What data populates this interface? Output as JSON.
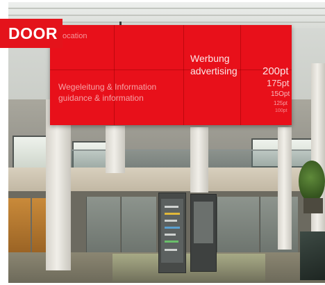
{
  "badge": {
    "text": "DOOR"
  },
  "led_wall": {
    "top_left": "ocation",
    "guidance_de": "Wegeleitung & Information",
    "guidance_en": "guidance & information",
    "ad_de": "Werbung",
    "ad_en": "advertising",
    "size_1": "200pt",
    "size_2": "175pt",
    "size_3": "15Opt",
    "size_4": "125pt",
    "size_5": "100pt"
  },
  "colors": {
    "led_red": "#e8101a",
    "badge_red": "#e4131b"
  }
}
